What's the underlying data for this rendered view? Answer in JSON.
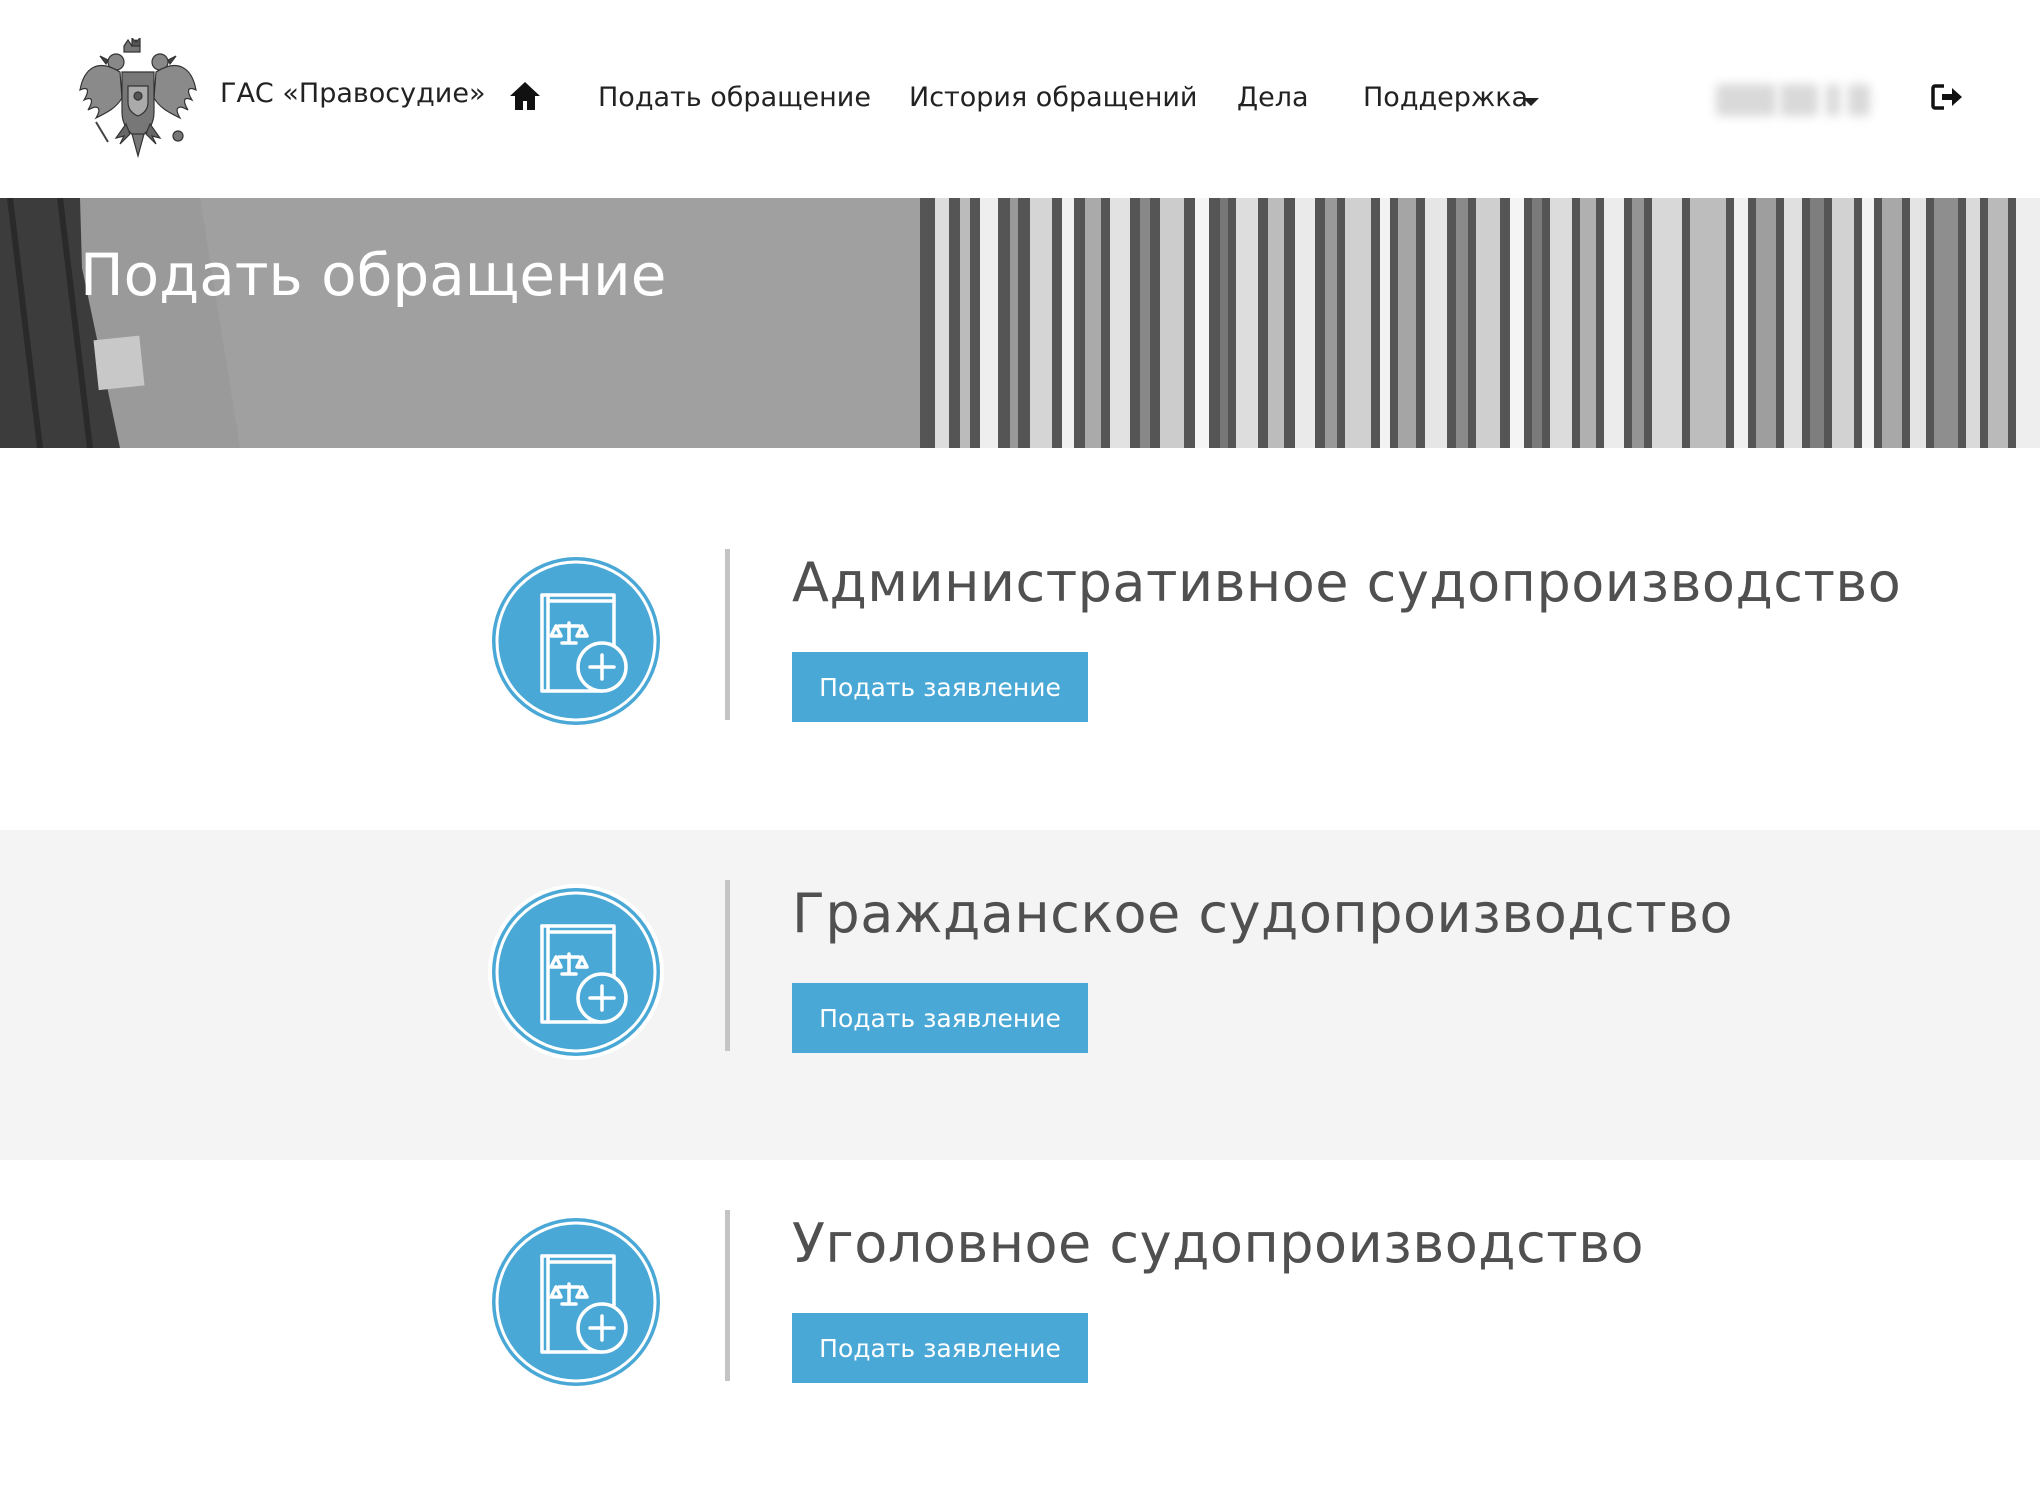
{
  "header": {
    "emblem_icon": "russian-coat-of-arms-icon",
    "brand": "ГАС «Правосудие»",
    "home_icon": "home-icon",
    "nav": [
      {
        "label": "Подать обращение"
      },
      {
        "label": "История обращений"
      },
      {
        "label": "Дела"
      },
      {
        "label": "Поддержка",
        "has_dropdown": true
      }
    ],
    "logout_icon": "sign-out-icon"
  },
  "banner": {
    "title": "Подать обращение"
  },
  "sections": [
    {
      "title": "Административное судопроизводство",
      "button": "Подать заявление",
      "icon": "law-book-add-icon"
    },
    {
      "title": "Гражданское судопроизводство",
      "button": "Подать заявление",
      "icon": "law-book-add-icon"
    },
    {
      "title": "Уголовное судопроизводство",
      "button": "Подать заявление",
      "icon": "law-book-add-icon"
    }
  ],
  "colors": {
    "accent": "#4aa8d6",
    "title_text": "#505050",
    "alt_section_bg": "#f4f4f4",
    "divider": "#c4c4c4"
  }
}
